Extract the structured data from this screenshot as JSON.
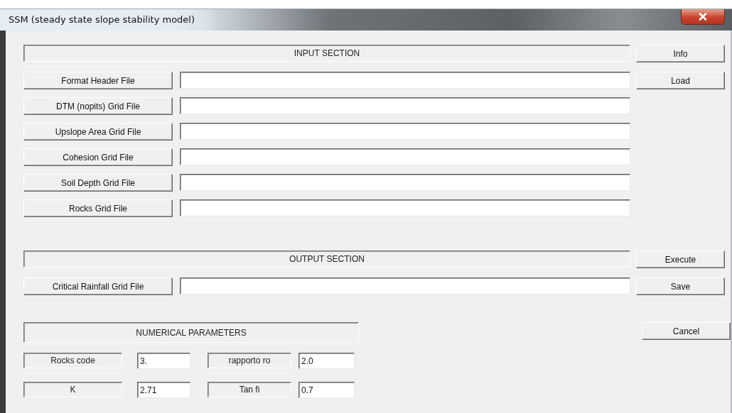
{
  "window": {
    "title": "SSM (steady state slope stability model)"
  },
  "input_section": {
    "heading": "INPUT SECTION",
    "files": [
      {
        "label": "Format Header File"
      },
      {
        "label": "DTM (nopits) Grid File"
      },
      {
        "label": "Upslope Area Grid File"
      },
      {
        "label": "Cohesion Grid File"
      },
      {
        "label": "Soil Depth Grid File"
      },
      {
        "label": "Rocks Grid File"
      }
    ],
    "side_buttons": [
      "Info",
      "Load"
    ]
  },
  "output_section": {
    "heading": "OUTPUT SECTION",
    "files": [
      {
        "label": "Critical Rainfall Grid File"
      }
    ],
    "side_buttons": [
      "Execute",
      "Save"
    ]
  },
  "parameters": {
    "heading": "NUMERICAL PARAMETERS",
    "fields": [
      {
        "label": "Rocks code",
        "value": "3."
      },
      {
        "label": "rapporto ro",
        "value": "2.0"
      },
      {
        "label": "K",
        "value": "2.71"
      },
      {
        "label": "Tan fi",
        "value": "0.7"
      }
    ],
    "side_buttons": [
      "Cancel"
    ]
  }
}
